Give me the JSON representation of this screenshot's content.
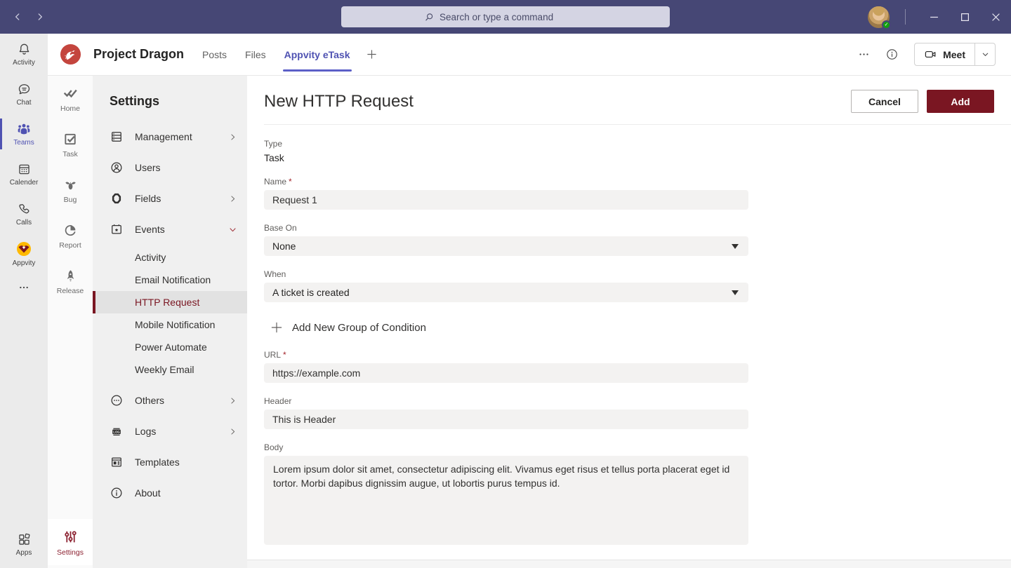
{
  "titlebar": {
    "search_placeholder": "Search or type a command"
  },
  "team_header": {
    "team_name": "Project Dragon",
    "tabs": [
      {
        "label": "Posts",
        "active": false
      },
      {
        "label": "Files",
        "active": false
      },
      {
        "label": "Appvity eTask",
        "active": true
      }
    ],
    "meet_label": "Meet"
  },
  "app_rail": {
    "items": [
      {
        "label": "Activity",
        "icon": "bell-icon",
        "active": false
      },
      {
        "label": "Chat",
        "icon": "chat-icon",
        "active": false
      },
      {
        "label": "Teams",
        "icon": "teams-icon",
        "active": true
      },
      {
        "label": "Calender",
        "icon": "calendar-icon",
        "active": false
      },
      {
        "label": "Calls",
        "icon": "phone-icon",
        "active": false
      },
      {
        "label": "Appvity",
        "icon": "appvity-icon",
        "active": false
      }
    ],
    "apps_label": "Apps"
  },
  "module_rail": {
    "items": [
      {
        "label": "Home",
        "icon": "home-icon"
      },
      {
        "label": "Task",
        "icon": "task-icon"
      },
      {
        "label": "Bug",
        "icon": "bug-icon"
      },
      {
        "label": "Report",
        "icon": "report-icon"
      },
      {
        "label": "Release",
        "icon": "release-icon"
      }
    ],
    "settings": {
      "label": "Settings",
      "active": true
    }
  },
  "settings_nav": {
    "title": "Settings",
    "items": [
      {
        "label": "Management",
        "expandable": true
      },
      {
        "label": "Users",
        "expandable": false
      },
      {
        "label": "Fields",
        "expandable": true
      },
      {
        "label": "Events",
        "expandable": true,
        "expanded": true,
        "children": [
          {
            "label": "Activity",
            "selected": false
          },
          {
            "label": "Email Notification",
            "selected": false
          },
          {
            "label": "HTTP Request",
            "selected": true
          },
          {
            "label": "Mobile Notification",
            "selected": false
          },
          {
            "label": "Power Automate",
            "selected": false
          },
          {
            "label": "Weekly Email",
            "selected": false
          }
        ]
      },
      {
        "label": "Others",
        "expandable": true
      },
      {
        "label": "Logs",
        "expandable": true
      },
      {
        "label": "Templates",
        "expandable": false
      },
      {
        "label": "About",
        "expandable": false
      }
    ]
  },
  "main": {
    "title": "New HTTP Request",
    "cancel_label": "Cancel",
    "add_label": "Add",
    "required_marker": "*",
    "form": {
      "type": {
        "label": "Type",
        "value": "Task"
      },
      "name": {
        "label": "Name",
        "required": true,
        "value": "Request 1"
      },
      "base_on": {
        "label": "Base On",
        "value": "None"
      },
      "when": {
        "label": "When",
        "value": "A ticket is created"
      },
      "add_condition_label": "Add New Group of Condition",
      "url": {
        "label": "URL",
        "required": true,
        "value": "https://example.com"
      },
      "header": {
        "label": "Header",
        "value": "This is Header"
      },
      "body": {
        "label": "Body",
        "value": "Lorem ipsum dolor sit amet, consectetur adipiscing elit. Vivamus eget risus et tellus porta placerat eget id tortor. Morbi dapibus dignissim augue, ut lobortis purus tempus id."
      }
    }
  },
  "colors": {
    "titlebar": "#464775",
    "teams_accent": "#4f52b2",
    "maroon_accent": "#7a1622",
    "appvity_orange": "#ffb900",
    "logo_red": "#c4453e",
    "input_bg": "#f3f2f1",
    "sidebar_bg": "#f0f0f0",
    "rail_bg": "#ebebeb"
  }
}
